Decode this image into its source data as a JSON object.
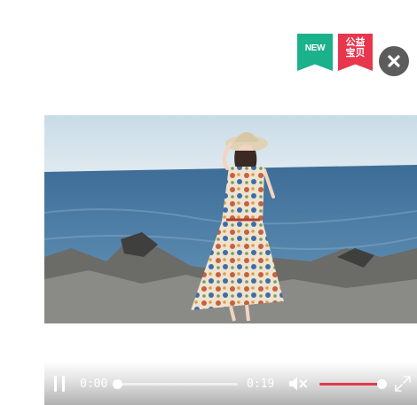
{
  "badges": {
    "new": "NEW",
    "charity": "公益\n宝贝"
  },
  "icons": {
    "close": "close-icon",
    "play_pause": "pause-icon",
    "mute": "volume-muted-icon",
    "fullscreen": "fullscreen-icon"
  },
  "player": {
    "current_time": "0:00",
    "duration": "0:19",
    "progress": 0,
    "volume": 1.0
  },
  "colors": {
    "badge_new": "#1bb18a",
    "badge_charity": "#e8364d",
    "volume_accent": "#e8364d"
  }
}
